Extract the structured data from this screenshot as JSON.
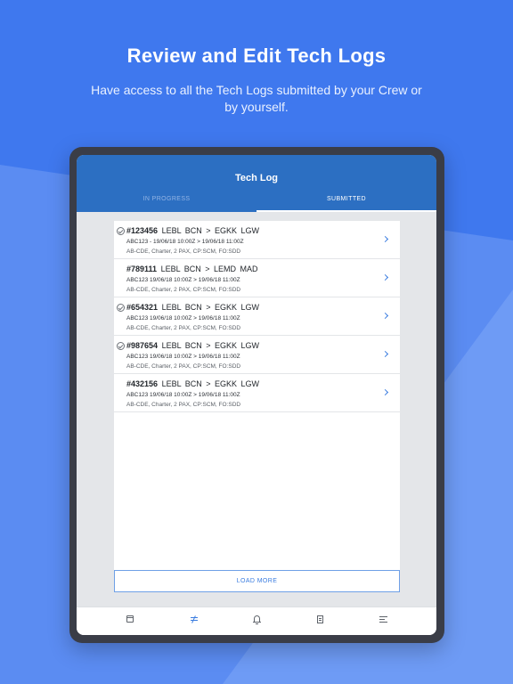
{
  "promo": {
    "headline": "Review and Edit Tech Logs",
    "subline": "Have access to all the Tech Logs submitted by your Crew or by yourself."
  },
  "app": {
    "title": "Tech Log",
    "tabs": [
      {
        "label": "IN PROGRESS",
        "active": false
      },
      {
        "label": "SUBMITTED",
        "active": true
      }
    ],
    "load_more_label": "LOAD MORE"
  },
  "logs": [
    {
      "number": "#123456",
      "route": "LEBL BCN > EGKK LGW",
      "details": "ABC123 - 19/06/18 10:00Z > 19/06/18 11:00Z",
      "crew": "AB-CDE, Charter, 2 PAX, CP:SCM, FO:SDD",
      "verified": true
    },
    {
      "number": "#789111",
      "route": "LEBL BCN > LEMD MAD",
      "details": "ABC123   19/06/18 10:00Z > 19/06/18 11:00Z",
      "crew": "AB-CDE, Charter, 2 PAX, CP:SCM, FO:SDD",
      "verified": false
    },
    {
      "number": "#654321",
      "route": "LEBL BCN > EGKK LGW",
      "details": "ABC123   19/06/18 10:00Z > 19/06/18 11:00Z",
      "crew": "AB-CDE, Charter, 2 PAX, CP:SCM, FO:SDD",
      "verified": true
    },
    {
      "number": "#987654",
      "route": "LEBL BCN > EGKK LGW",
      "details": "ABC123   19/06/18 10:00Z > 19/06/18 11:00Z",
      "crew": "AB-CDE, Charter, 2 PAX, CP:SCM, FO:SDD",
      "verified": true
    },
    {
      "number": "#432156",
      "route": "LEBL BCN > EGKK LGW",
      "details": "ABC123   19/06/18 10:00Z > 19/06/18 11:00Z",
      "crew": "AB-CDE, Charter, 2 PAX, CP:SCM, FO:SDD",
      "verified": false
    }
  ],
  "bottom_nav": [
    {
      "icon": "calendar-icon",
      "active": false
    },
    {
      "icon": "tech-log-icon",
      "active": true
    },
    {
      "icon": "bell-icon",
      "active": false
    },
    {
      "icon": "document-icon",
      "active": false
    },
    {
      "icon": "menu-icon",
      "active": false
    }
  ],
  "colors": {
    "background": "#3f78ee",
    "app_bar": "#2c6fc2",
    "accent": "#3b7de0"
  }
}
